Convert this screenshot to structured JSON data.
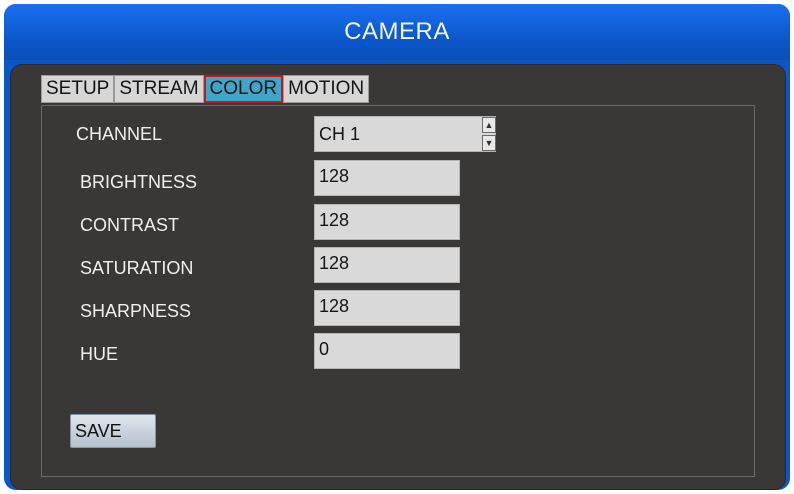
{
  "window": {
    "title": "CAMERA"
  },
  "tabs": [
    {
      "label": "SETUP",
      "active": false
    },
    {
      "label": "STREAM",
      "active": false
    },
    {
      "label": "COLOR",
      "active": true
    },
    {
      "label": "MOTION",
      "active": false
    }
  ],
  "channel": {
    "label": "CHANNEL",
    "value": "CH 1"
  },
  "fields": [
    {
      "label": "BRIGHTNESS",
      "value": "128"
    },
    {
      "label": "CONTRAST",
      "value": "128"
    },
    {
      "label": "SATURATION",
      "value": "128"
    },
    {
      "label": "SHARPNESS",
      "value": "128"
    },
    {
      "label": "HUE",
      "value": "0"
    }
  ],
  "save_label": "SAVE",
  "colors": {
    "title_bar": "#0b57c8",
    "panel": "#3a3836",
    "active_tab": "#3fa5c9",
    "active_tab_border": "#c01a1a"
  }
}
